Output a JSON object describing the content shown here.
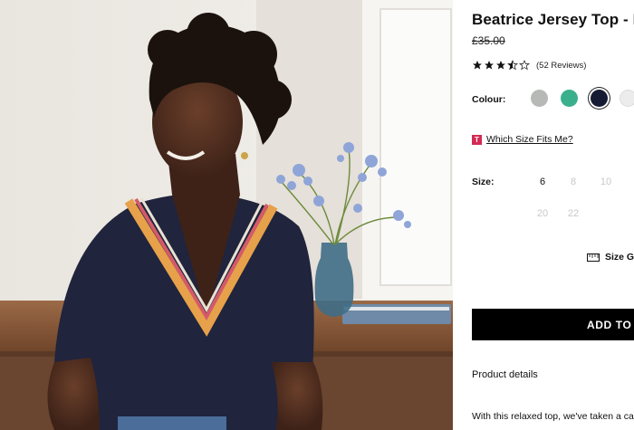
{
  "product": {
    "title": "Beatrice Jersey Top - Nav",
    "price": "£35.00",
    "rating_value": 3.5,
    "rating_max": 5,
    "reviews": "(52 Reviews)"
  },
  "colour": {
    "label": "Colour:",
    "swatches": [
      {
        "name": "grey",
        "color": "#b7b9b6"
      },
      {
        "name": "green",
        "color": "#3aaf8c"
      },
      {
        "name": "navy",
        "color": "#161b33",
        "selected": true
      },
      {
        "name": "white",
        "color": "#ececec"
      }
    ]
  },
  "size_fit_link": {
    "badge": "T",
    "label": "Which Size Fits Me?"
  },
  "size": {
    "label": "Size:",
    "options": [
      "6",
      "8",
      "10",
      "20",
      "22"
    ],
    "available": [
      "6"
    ]
  },
  "size_guide": {
    "label": "Size G"
  },
  "add_to_bag": {
    "label": "ADD TO B"
  },
  "details": {
    "heading": "Product details",
    "description": "With this relaxed top, we've taken a ca"
  },
  "colors": {
    "accent": "#000000",
    "badge": "#d42a55",
    "unavailable": "#c8c8c8"
  }
}
